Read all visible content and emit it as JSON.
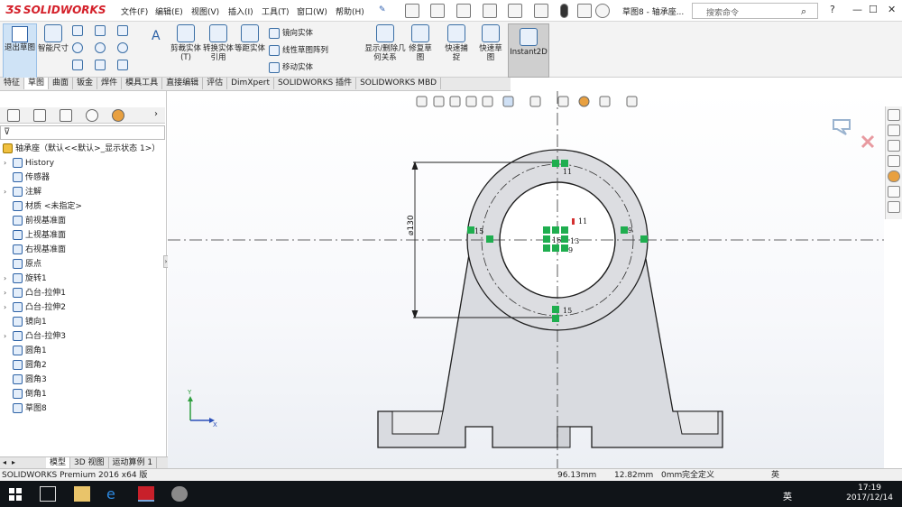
{
  "app": {
    "logo_text": "SOLIDWORKS",
    "document_title": "草图8 - 轴承座...",
    "search_placeholder": "搜索命令",
    "win_min": "—",
    "win_max": "☐",
    "win_close": "✕",
    "help_symbol": "?"
  },
  "menu": [
    "文件(F)",
    "编辑(E)",
    "视图(V)",
    "插入(I)",
    "工具(T)",
    "窗口(W)",
    "帮助(H)"
  ],
  "ribbon": {
    "exit_sketch": "退出草图",
    "smart_dimension": "智能尺寸",
    "trim": "剪裁实体(T)",
    "convert": "转换实体引用",
    "offset": "等距实体",
    "mirror": "镜向实体",
    "linear_pattern": "线性草图阵列",
    "move": "移动实体",
    "display_relations": "显示/删除几何关系",
    "repair": "修复草图",
    "quick_snaps": "快速捕捉",
    "rapid_sketch": "快速草图",
    "instant2d": "Instant2D"
  },
  "tabs": [
    "特征",
    "草图",
    "曲面",
    "钣金",
    "焊件",
    "模具工具",
    "直接编辑",
    "评估",
    "DimXpert",
    "SOLIDWORKS 插件",
    "SOLIDWORKS MBD"
  ],
  "active_tab": "草图",
  "tree": {
    "root": "轴承座（默认<<默认>_显示状态 1>）",
    "items": [
      {
        "label": "History",
        "arrow": true
      },
      {
        "label": "传感器",
        "arrow": false
      },
      {
        "label": "注解",
        "arrow": true
      },
      {
        "label": "材质 <未指定>",
        "arrow": false
      },
      {
        "label": "前视基准面",
        "arrow": false
      },
      {
        "label": "上视基准面",
        "arrow": false
      },
      {
        "label": "右视基准面",
        "arrow": false
      },
      {
        "label": "原点",
        "arrow": false
      },
      {
        "label": "旋转1",
        "arrow": true
      },
      {
        "label": "凸台-拉伸1",
        "arrow": true
      },
      {
        "label": "凸台-拉伸2",
        "arrow": true
      },
      {
        "label": "镜向1",
        "arrow": false
      },
      {
        "label": "凸台-拉伸3",
        "arrow": true
      },
      {
        "label": "圆角1",
        "arrow": false
      },
      {
        "label": "圆角2",
        "arrow": false
      },
      {
        "label": "圆角3",
        "arrow": false
      },
      {
        "label": "倒角1",
        "arrow": false
      },
      {
        "label": "草图8",
        "arrow": false
      }
    ]
  },
  "bottom_tabs": [
    "模型",
    "3D 视图",
    "运动算例 1"
  ],
  "drawing": {
    "dimension": "⌀130",
    "relation_labels": [
      "11",
      "11",
      "15",
      "16",
      "13",
      "9",
      "9",
      "15"
    ],
    "axis_x": "X",
    "axis_y": "Y"
  },
  "status": {
    "product": "SOLIDWORKS Premium 2016 x64 版",
    "x": "96.13mm",
    "y": "12.82mm",
    "z": "0mm",
    "state": "完全定义",
    "lang": "英"
  },
  "taskbar": {
    "time": "17:19",
    "date": "2017/12/14",
    "lang": "英"
  }
}
